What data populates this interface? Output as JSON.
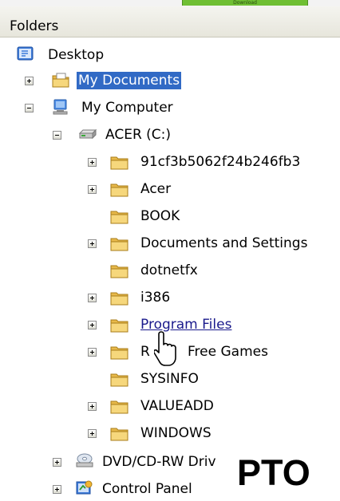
{
  "top_strip": {
    "button_label": "Download"
  },
  "panel": {
    "title": "Folders"
  },
  "tree": {
    "desktop": "Desktop",
    "my_documents": "My Documents",
    "my_computer": "My Computer",
    "drive_c": "ACER (C:)",
    "folders": [
      "91cf3b5062f24b246fb3",
      "Acer",
      "BOOK",
      "Documents and Settings",
      "dotnetfx",
      "i386",
      "Program Files",
      "R",
      "Free Games",
      "SYSINFO",
      "VALUEADD",
      "WINDOWS"
    ],
    "dvd_drive": "DVD/CD-RW Driv",
    "control_panel": "Control Panel"
  },
  "overlay": {
    "pto": "PTO"
  },
  "colors": {
    "selection": "#316ac5",
    "folder": "#f2cf6b",
    "download_button": "#6fbf33"
  }
}
